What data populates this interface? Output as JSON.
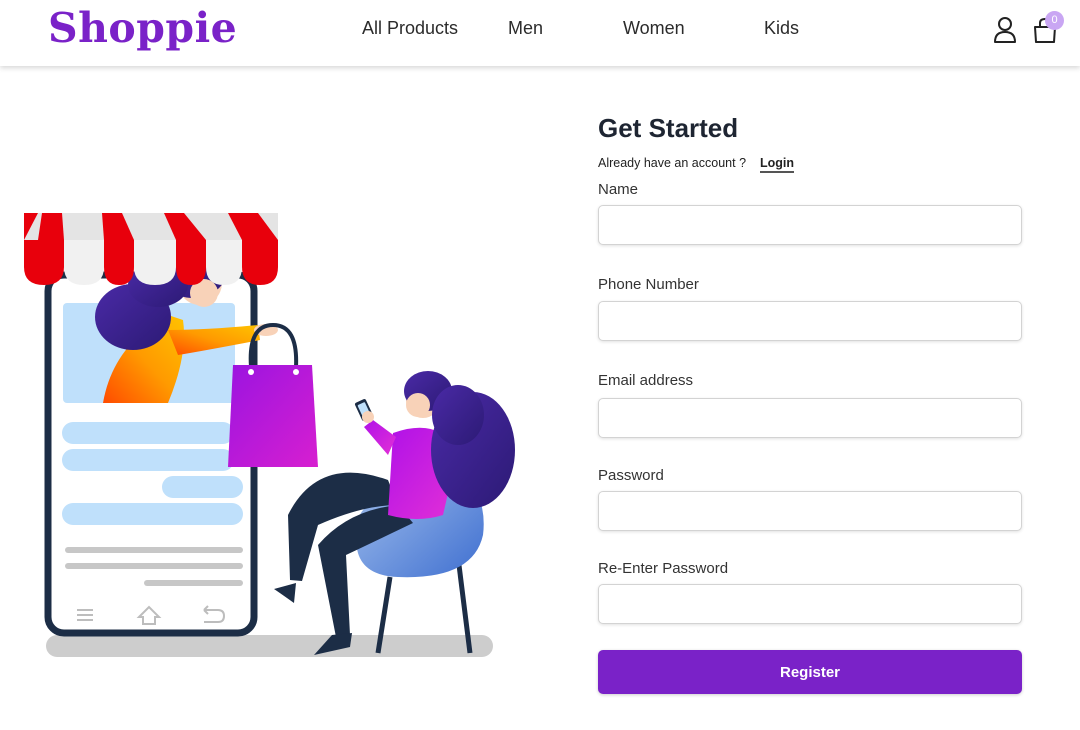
{
  "brand": {
    "name": "Shoppie",
    "color": "#7a22c8"
  },
  "nav": {
    "items": [
      {
        "label": "All Products"
      },
      {
        "label": "Men"
      },
      {
        "label": "Women"
      },
      {
        "label": "Kids"
      }
    ]
  },
  "header_icons": {
    "account_icon": "user-icon",
    "cart_icon": "shopping-bag-icon",
    "cart_count": "0"
  },
  "form": {
    "title": "Get Started",
    "account_prompt": "Already have an account ?",
    "login_label": "Login",
    "fields": [
      {
        "label": "Name",
        "value": ""
      },
      {
        "label": "Phone Number",
        "value": ""
      },
      {
        "label": "Email address",
        "value": ""
      },
      {
        "label": "Password",
        "value": ""
      },
      {
        "label": "Re-Enter Password",
        "value": ""
      }
    ],
    "submit_label": "Register"
  },
  "colors": {
    "accent": "#7a22c8",
    "awning_red": "#e8000c",
    "bag_magenta": "#c21dd8"
  }
}
